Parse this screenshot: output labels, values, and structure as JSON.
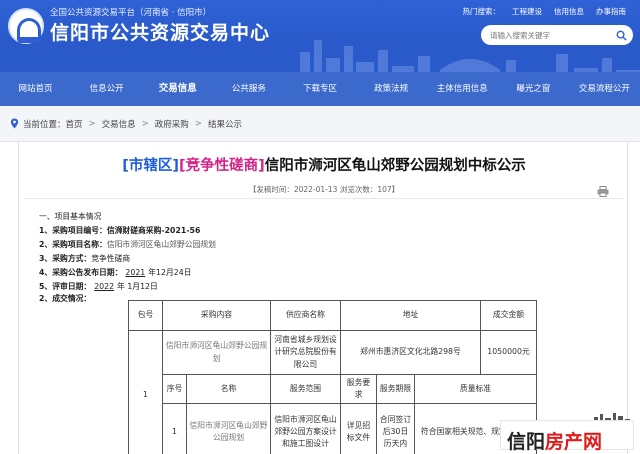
{
  "header": {
    "platform_line": "全国公共资源交易平台（河南省 · 信阳市）",
    "site_title": "信阳市公共资源交易中心",
    "top_links": [
      "热门搜索：",
      "工程建设",
      "信用信息",
      "办事指南"
    ],
    "search_placeholder": "请输入搜索关键字"
  },
  "nav": {
    "items": [
      "网站首页",
      "信息公开",
      "交易信息",
      "公共服务",
      "下载专区",
      "政策法规",
      "主体信用信息",
      "曝光之窗",
      "交易流程公开"
    ],
    "active_index": 2
  },
  "breadcrumb": {
    "prefix": "当前位置：",
    "items": [
      "首页",
      "交易信息",
      "政府采购",
      "结果公示"
    ]
  },
  "article": {
    "tag_district": "[市辖区]",
    "tag_method": "[竞争性磋商]",
    "title": "信阳市浉河区龟山郊野公园规划中标公示",
    "meta": "【发稿时间：2022-01-13  浏览次数：107】",
    "section1": "一、项目基本情况",
    "items": {
      "no_label": "1、采购项目编号：",
      "no_value": "信浉财磋商采购-2021-56",
      "name_label": "2、采购项目名称：",
      "name_value": "信阳市浉河区龟山郊野公园规划",
      "method_label": "3、采购方式：",
      "method_value": "竞争性磋商",
      "publish_label": "4、采购公告发布日期：",
      "publish_year": "2021",
      "publish_rest": "年12月24日",
      "review_label": "5、评审日期：",
      "review_year": "2022",
      "review_rest": "年  1月12日"
    },
    "section2": "2、成交情况："
  },
  "result_table": {
    "h_pkg": "包号",
    "h_content": "采购内容",
    "h_supplier": "供应商名称",
    "h_address": "地址",
    "h_amount": "成交金额",
    "pkg_no": "1",
    "content": "信阳市浉河区龟山郊野公园规划",
    "supplier": "河南省城乡规划设计研究总院股份有限公司",
    "address": "郑州市惠济区文化北路298号",
    "amount": "1050000元",
    "s_seq": "序号",
    "s_name": "名称",
    "s_scope": "服务范围",
    "s_req": "服务要求",
    "s_period": "服务期限",
    "s_quality": "质量标准",
    "r_seq": "1",
    "r_name": "信阳市浉河区龟山郊野公园规划",
    "r_scope": "信阳市浉河区龟山郊野公园方案设计和施工图设计",
    "r_req": "详见招标文件",
    "r_period": "合同签订后30日历天内",
    "r_quality": "符合国家相关规范、规定的要求"
  },
  "watermark": {
    "part_a": "信阳",
    "part_b": "房产网"
  },
  "colors": {
    "brand_blue": "#2f62d6",
    "tag_blue": "#1f5ee0",
    "tag_magenta": "#d4248a",
    "watermark_red": "#e21b1b"
  }
}
